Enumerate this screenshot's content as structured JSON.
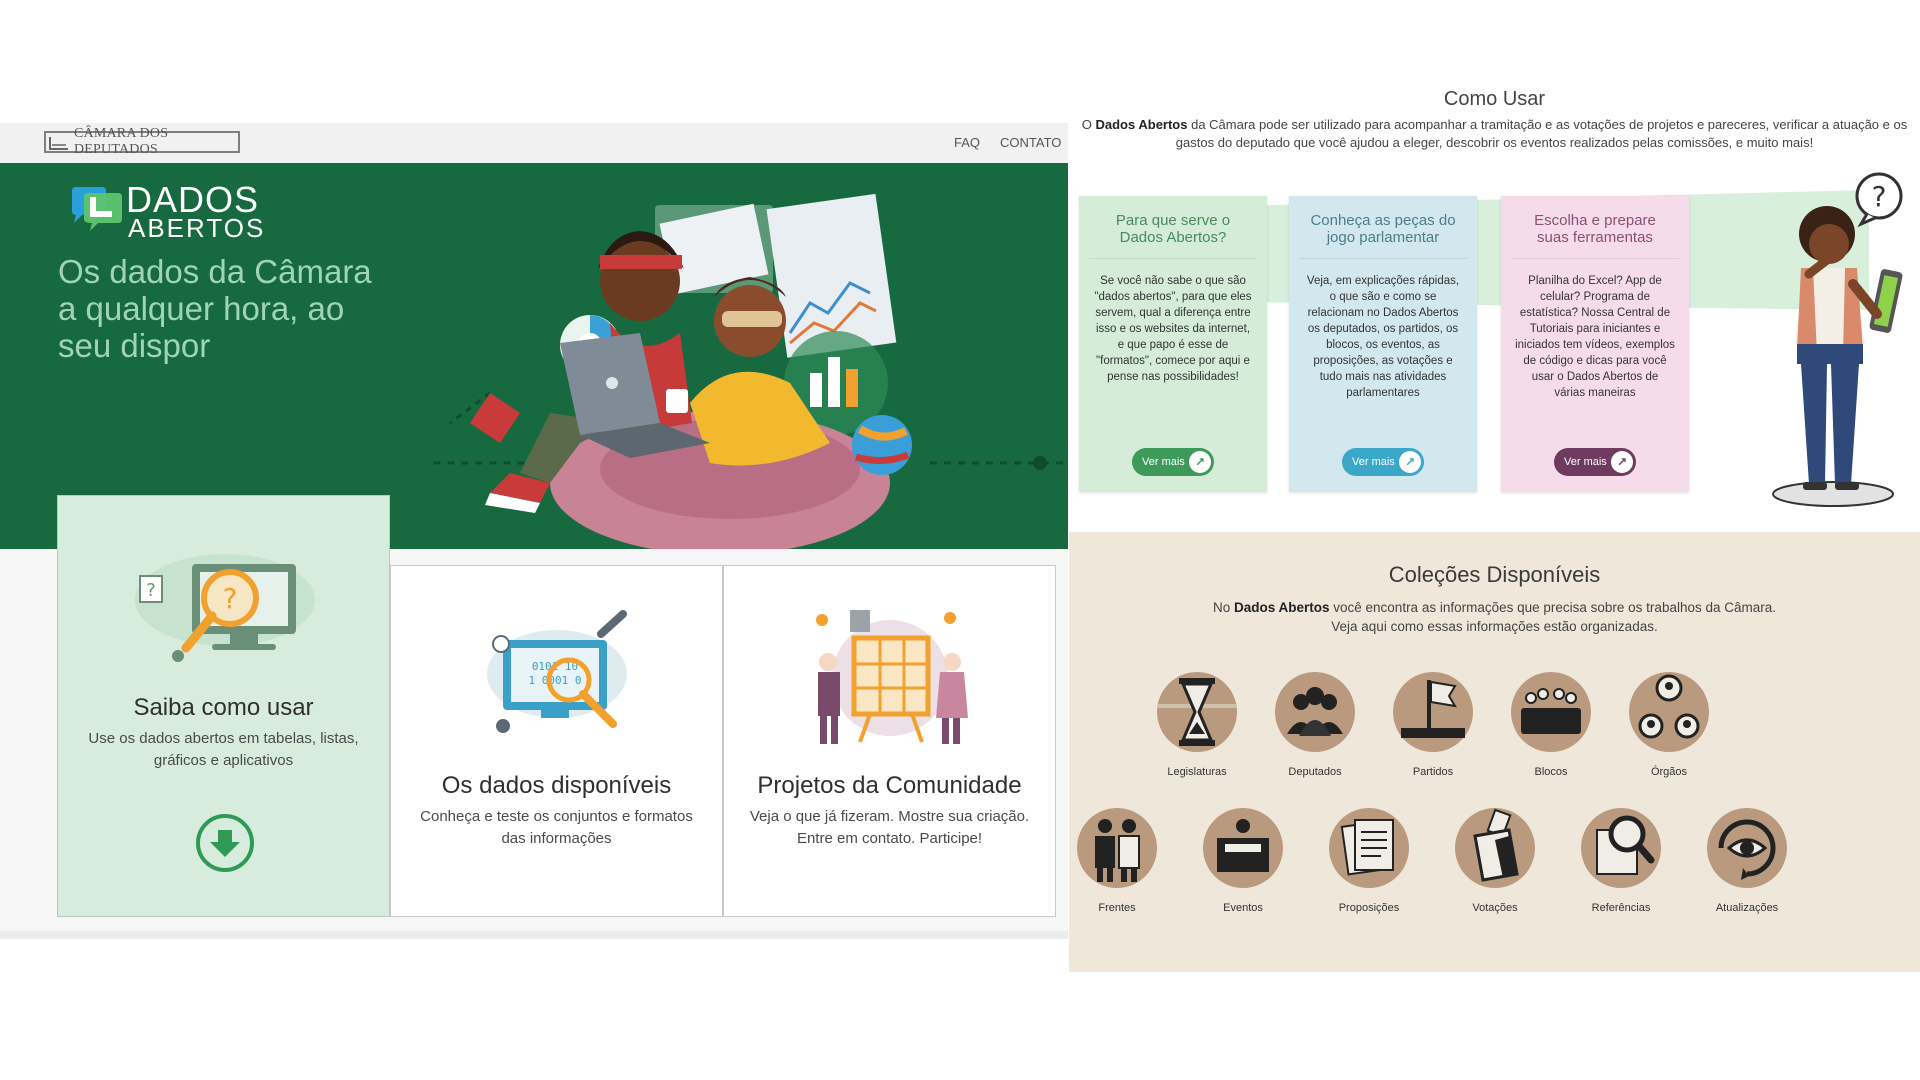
{
  "left": {
    "header": {
      "logo_text": "CÂMARA DOS DEPUTADOS",
      "nav": [
        "FAQ",
        "CONTATO"
      ]
    },
    "hero": {
      "brand_line1": "DADOS",
      "brand_line2": "ABERTOS",
      "headline": "Os dados da Câmara a qualquer hora, ao seu dispor"
    },
    "cards": [
      {
        "title": "Saiba como usar",
        "desc": "Use os dados abertos em tabelas, listas, gráficos e aplicativos"
      },
      {
        "title": "Os dados disponíveis",
        "desc": "Conheça e teste os conjuntos e formatos das informações"
      },
      {
        "title": "Projetos da Comunidade",
        "desc": "Veja o que já fizeram. Mostre sua criação. Entre em contato. Participe!"
      }
    ]
  },
  "right": {
    "como_usar": {
      "title": "Como Usar",
      "desc_bold": "Dados Abertos",
      "desc_pre": "O ",
      "desc_post": " da Câmara pode ser utilizado para acompanhar a tramitação e as votações de projetos e pareceres, verificar a atuação e os gastos do deputado que você ajudou a eleger, descobrir os eventos realizados pelas comissões, e muito mais!",
      "cards": [
        {
          "title": "Para que serve o Dados Abertos?",
          "text": "Se você não sabe o que são \"dados abertos\", para que eles servem, qual a diferença entre isso e os websites da internet, e que papo é esse de \"formatos\", comece por aqui e pense nas possibilidades!",
          "button": "Ver mais"
        },
        {
          "title": "Conheça as peças do jogo parlamentar",
          "text": "Veja, em explicações rápidas, o que são e como se relacionam no Dados Abertos os deputados, os partidos, os blocos, os eventos, as proposições, as votações e tudo mais nas atividades parlamentares",
          "button": "Ver mais"
        },
        {
          "title": "Escolha e prepare suas ferramentas",
          "text": "Planilha do Excel? App de celular? Programa de estatística? Nossa Central de Tutoriais para iniciantes e iniciados tem vídeos, exemplos de código e dicas para você usar o Dados Abertos de várias maneiras",
          "button": "Ver mais"
        }
      ]
    },
    "colecoes": {
      "title": "Coleções Disponíveis",
      "desc_pre": "No ",
      "desc_bold": "Dados Abertos",
      "desc_post": " você encontra as informações que precisa sobre os trabalhos da Câmara.\nVeja aqui como essas informações estão organizadas.",
      "items": [
        {
          "label": "Legislaturas",
          "icon": "hourglass-icon"
        },
        {
          "label": "Deputados",
          "icon": "people-group-icon"
        },
        {
          "label": "Partidos",
          "icon": "flag-icon"
        },
        {
          "label": "Blocos",
          "icon": "meeting-table-icon"
        },
        {
          "label": "Órgãos",
          "icon": "org-chart-icon"
        },
        {
          "label": "Frentes",
          "icon": "two-people-icon"
        },
        {
          "label": "Eventos",
          "icon": "podium-icon"
        },
        {
          "label": "Proposições",
          "icon": "documents-icon"
        },
        {
          "label": "Votações",
          "icon": "ballot-box-icon"
        },
        {
          "label": "Referências",
          "icon": "magnifier-document-icon"
        },
        {
          "label": "Atualizações",
          "icon": "eye-refresh-icon"
        }
      ]
    }
  },
  "colors": {
    "hero_green": "#176a40",
    "headline_green": "#9fd4b4",
    "card1_bg": "#d7ecdd",
    "colecoes_bg": "#efe7da",
    "btn_green": "#3e9a5a",
    "btn_blue": "#3ba7c9",
    "btn_purple": "#6e3a5f"
  }
}
